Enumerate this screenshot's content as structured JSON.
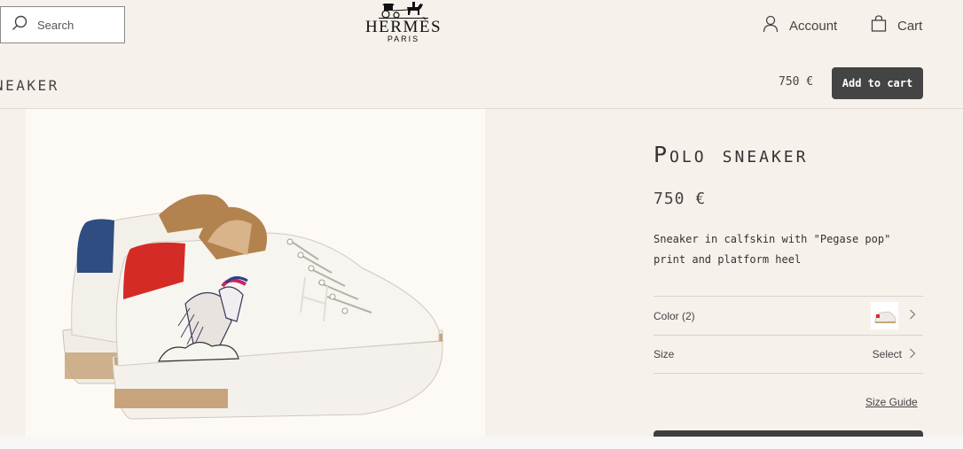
{
  "header": {
    "search_placeholder": "Search",
    "logo_brand": "HERMÈS",
    "logo_city": "PARIS",
    "account_label": "Account",
    "cart_label": "Cart"
  },
  "sticky_bar": {
    "title": "NEAKER",
    "price": "750 €",
    "add_to_cart_label": "Add to cart"
  },
  "product": {
    "title": "Polo sneaker",
    "price": "750 €",
    "description": "Sneaker in calfskin with \"Pegase pop\" print and platform heel",
    "color_label": "Color (2)",
    "size_label": "Size",
    "size_value": "Select",
    "size_guide_label": "Size Guide"
  },
  "colors": {
    "background": "#f6f1eb",
    "image_panel": "#fdfaf6",
    "button": "#444444",
    "text": "#444444"
  },
  "icons": {
    "search": "search-icon",
    "account": "user-icon",
    "cart": "shopping-bag-icon",
    "chevron": "chevron-right-icon"
  }
}
